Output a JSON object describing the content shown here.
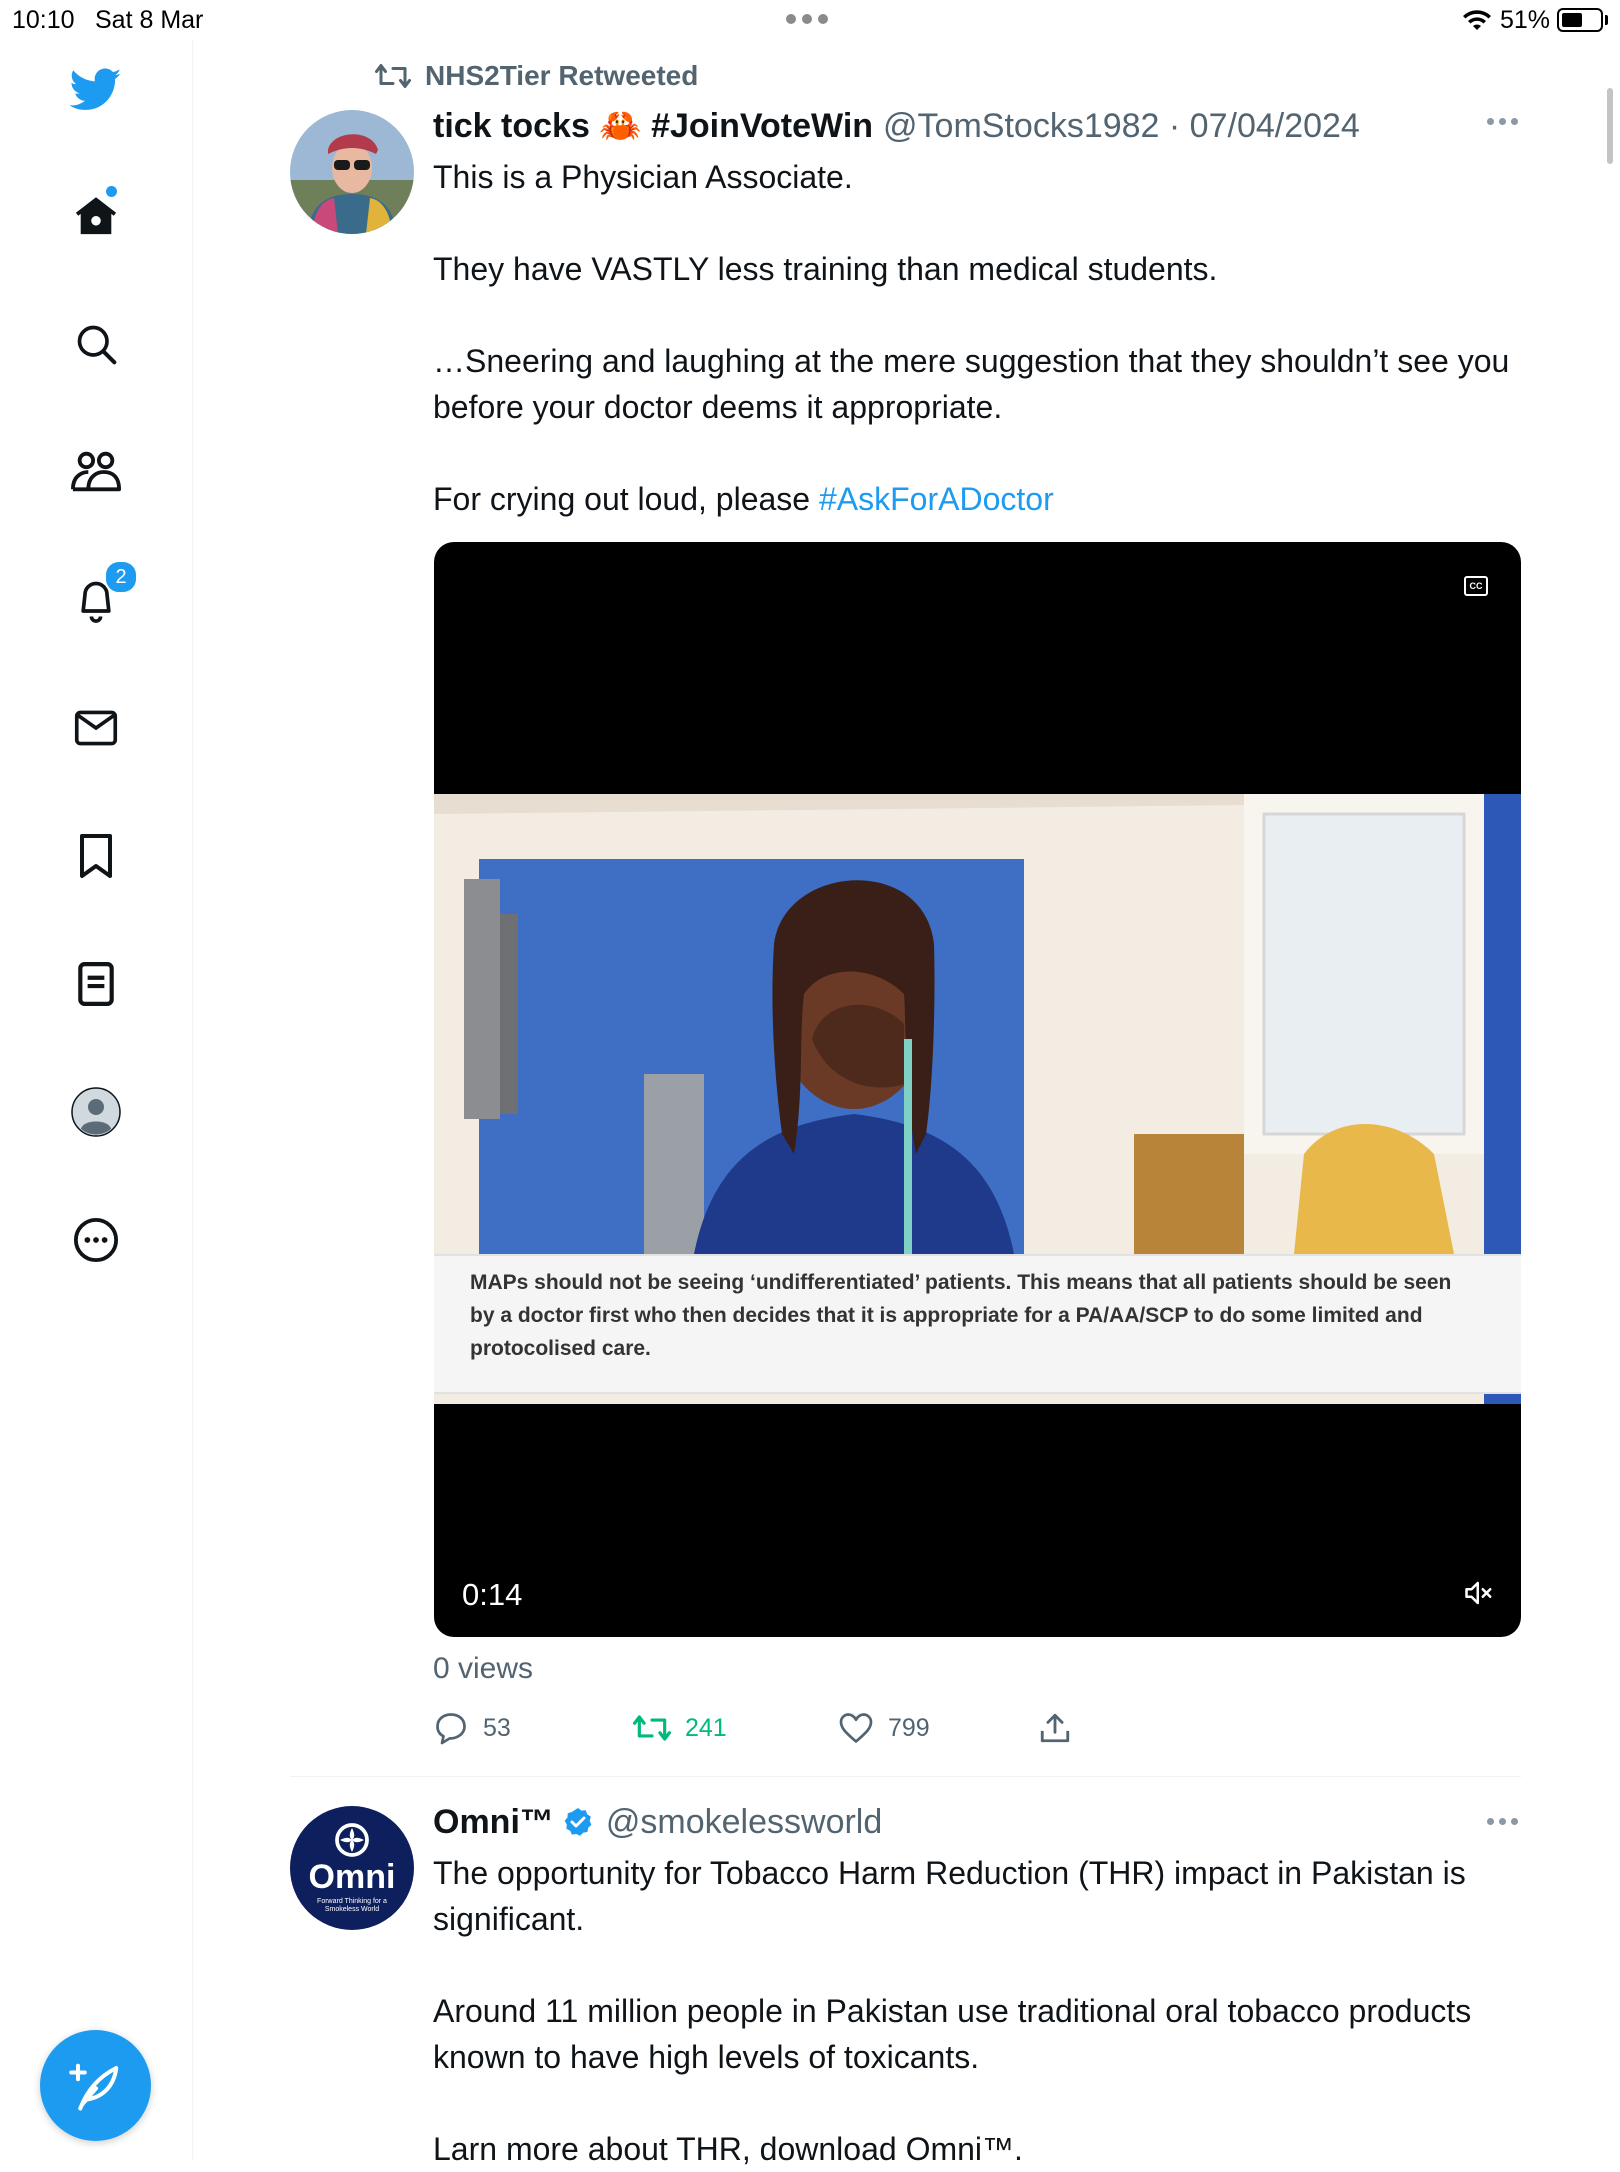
{
  "status_bar": {
    "time": "10:10",
    "date": "Sat 8 Mar",
    "battery": "51%"
  },
  "sidebar": {
    "notification_count": "2"
  },
  "tweet1": {
    "retweeted_by": "NHS2Tier Retweeted",
    "author_name": "tick tocks 🦀 #JoinVoteWin",
    "handle_date": "@TomStocks1982 · 07/04/2024",
    "body": [
      "This is a Physician Associate.",
      "They have VASTLY less training than medical students.",
      "…Sneering and laughing at the mere suggestion that they shouldn’t see you before your doctor deems it appropriate."
    ],
    "last_line_prefix": "For crying out loud, please ",
    "hashtag": "#AskForADoctor",
    "video": {
      "caption": "MAPs should not be seeing ‘undifferentiated’ patients. This means that all patients should be seen by a doctor first who then decides that it is appropriate for a PA/AA/SCP to do some limited and protocolised care.",
      "cc_label": "CC",
      "duration": "0:14"
    },
    "views": "0 views",
    "replies": "53",
    "retweets": "241",
    "likes": "799"
  },
  "tweet2": {
    "author_name": "Omni™",
    "handle": "@smokelessworld",
    "avatar_word": "Omni",
    "avatar_tagline": "Forward Thinking for a Smokeless World",
    "body": [
      "The opportunity for Tobacco Harm Reduction (THR) impact in Pakistan is significant.",
      "Around 11 million people in Pakistan use traditional oral tobacco products known to have high levels of toxicants.",
      "Larn more about THR, download Omni™."
    ]
  },
  "colors": {
    "accent": "#1d9bf0",
    "retweet_green": "#00ba7c",
    "secondary_text": "#536471"
  }
}
